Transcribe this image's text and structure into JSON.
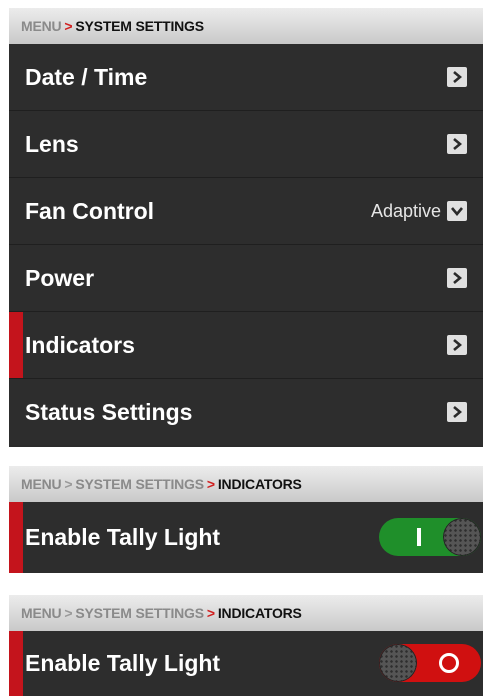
{
  "panel1": {
    "breadcrumb": {
      "root": "MENU",
      "current": "SYSTEM SETTINGS"
    },
    "items": [
      {
        "label": "Date / Time"
      },
      {
        "label": "Lens"
      },
      {
        "label": "Fan Control",
        "value": "Adaptive"
      },
      {
        "label": "Power"
      },
      {
        "label": "Indicators",
        "selected": true
      },
      {
        "label": "Status Settings"
      }
    ]
  },
  "panel2": {
    "breadcrumb": {
      "root": "MENU",
      "middle": "SYSTEM SETTINGS",
      "current": "INDICATORS"
    },
    "item": {
      "label": "Enable Tally Light",
      "state": "on"
    }
  },
  "panel3": {
    "breadcrumb": {
      "root": "MENU",
      "middle": "SYSTEM SETTINGS",
      "current": "INDICATORS"
    },
    "item": {
      "label": "Enable Tally Light",
      "state": "off"
    }
  },
  "colors": {
    "accent_red": "#c4141c",
    "toggle_on": "#1f8f2a",
    "toggle_off": "#d01010",
    "row_bg": "#2d2d2d"
  }
}
